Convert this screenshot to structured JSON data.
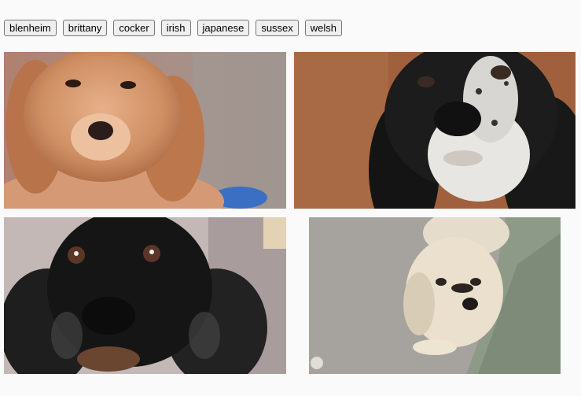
{
  "breeds": [
    {
      "label": "blenheim"
    },
    {
      "label": "brittany"
    },
    {
      "label": "cocker"
    },
    {
      "label": "irish"
    },
    {
      "label": "japanese"
    },
    {
      "label": "sussex"
    },
    {
      "label": "welsh"
    }
  ],
  "photos": [
    {
      "subject": "golden cocker spaniel puppy"
    },
    {
      "subject": "black and white cocker spaniel"
    },
    {
      "subject": "black cocker spaniel"
    },
    {
      "subject": "cream cocker spaniel puppy on carpet"
    }
  ]
}
